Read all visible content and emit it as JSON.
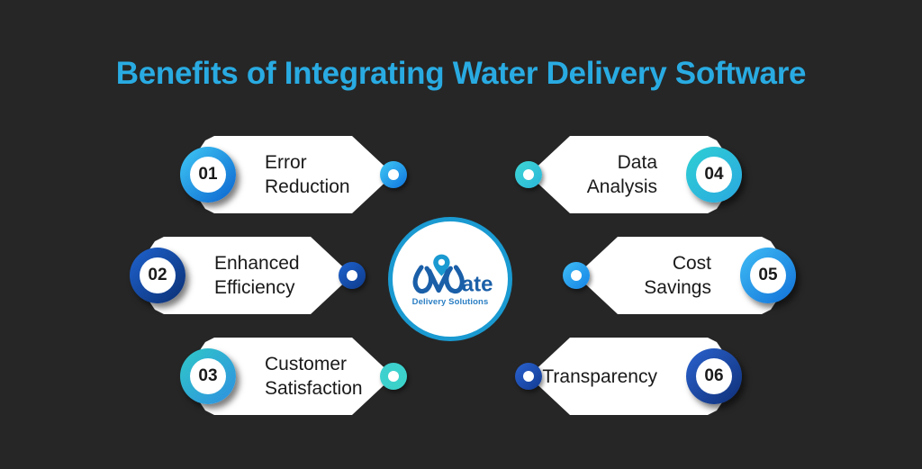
{
  "page": {
    "background_color": "#262626",
    "title": "Benefits of Integrating Water Delivery Software",
    "title_color": "#29ABE2"
  },
  "logo": {
    "name": "water-delivery-solutions-logo",
    "wordmark": "ater",
    "tagline": "Delivery Solutions",
    "primary_color": "#1A9AD1",
    "text_color": "#2B7FC4"
  },
  "benefits": [
    {
      "number": "01",
      "label": "Error\nReduction",
      "side": "left",
      "ring_from": "#3fc9f5",
      "ring_to": "#0b63cf",
      "dot_from": "#3fc9f5",
      "dot_to": "#0f74de"
    },
    {
      "number": "02",
      "label": "Enhanced\nEfficiency",
      "side": "left",
      "ring_from": "#1f63cf",
      "ring_to": "#0b2f72",
      "dot_from": "#1f63cf",
      "dot_to": "#0d3a8a"
    },
    {
      "number": "03",
      "label": "Customer\nSatisfaction",
      "side": "left",
      "ring_from": "#2fc8c8",
      "ring_to": "#2f8fe0",
      "dot_from": "#3ed0d0",
      "dot_to": "#3ad2c8"
    },
    {
      "number": "04",
      "label": "Data\nAnalysis",
      "side": "right",
      "ring_from": "#2ecfd4",
      "ring_to": "#2aa8e0",
      "dot_from": "#3ed6d6",
      "dot_to": "#2ab6d8"
    },
    {
      "number": "05",
      "label": "Cost\nSavings",
      "side": "right",
      "ring_from": "#3fbdf5",
      "ring_to": "#1170d8",
      "dot_from": "#3fbdf5",
      "dot_to": "#1583e6"
    },
    {
      "number": "06",
      "label": "Transparency",
      "side": "right",
      "ring_from": "#2a63cf",
      "ring_to": "#0f2f77",
      "dot_from": "#2a63cf",
      "dot_to": "#123a92"
    }
  ]
}
